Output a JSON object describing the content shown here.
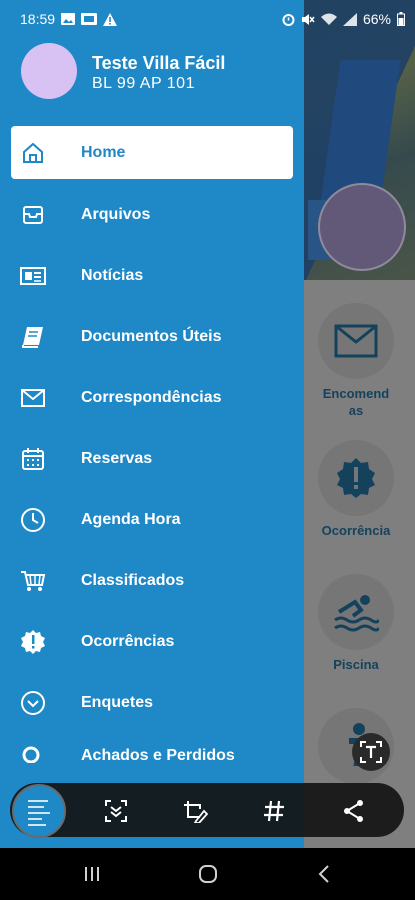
{
  "status_bar": {
    "time": "18:59",
    "battery": "66%"
  },
  "drawer": {
    "user_name": "Teste Villa Fácil",
    "unit": "BL 99 AP 101",
    "items": [
      {
        "label": "Home",
        "icon": "home-icon",
        "active": true
      },
      {
        "label": "Arquivos",
        "icon": "inbox-icon"
      },
      {
        "label": "Notícias",
        "icon": "newspaper-icon"
      },
      {
        "label": "Documentos Úteis",
        "icon": "book-icon"
      },
      {
        "label": "Correspondências",
        "icon": "envelope-icon"
      },
      {
        "label": "Reservas",
        "icon": "calendar-icon"
      },
      {
        "label": "Agenda Hora",
        "icon": "clock-icon"
      },
      {
        "label": "Classificados",
        "icon": "cart-icon"
      },
      {
        "label": "Ocorrências",
        "icon": "alert-badge-icon"
      },
      {
        "label": "Enquetes",
        "icon": "chevron-circle-icon"
      },
      {
        "label": "Achados e Perdidos",
        "icon": "search-icon"
      }
    ]
  },
  "background": {
    "tiles": [
      {
        "label": "Encomendas",
        "icon": "envelope-icon"
      },
      {
        "label": "Ocorrência",
        "icon": "alert-badge-icon"
      },
      {
        "label": "Piscina",
        "icon": "swimmer-icon"
      }
    ]
  },
  "colors": {
    "drawer_bg": "#1f88c6",
    "accent_text": "#1e5f86",
    "avatar": "#d7c2f3"
  }
}
